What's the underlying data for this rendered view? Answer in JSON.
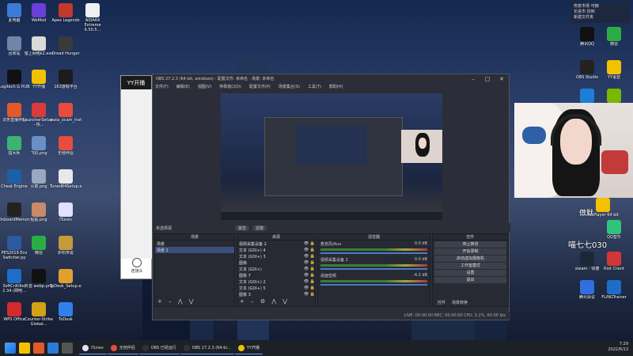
{
  "desktop_left_col1": [
    {
      "label": "此电脑",
      "color": "#3a7bd5"
    },
    {
      "label": "回收站",
      "color": "#6f86a8"
    },
    {
      "label": "Logitech G HUB",
      "color": "#111111"
    },
    {
      "label": "法务直播伴侣",
      "color": "#e05a2b"
    },
    {
      "label": "猎大师",
      "color": "#3cb371"
    },
    {
      "label": "Cheat Engine",
      "color": "#1d5fa8"
    },
    {
      "label": "OnboardMemoryManager",
      "color": "#222222"
    },
    {
      "label": "PES2019 Eco Switcher.py",
      "color": "#2c5aa0"
    },
    {
      "label": "SoftCnKiller 2.34 (网吧...",
      "color": "#1d6ec8"
    },
    {
      "label": "WPS Office",
      "color": "#d12b2b"
    }
  ],
  "desktop_left_col2": [
    {
      "label": "WeMod",
      "color": "#6a3fd8"
    },
    {
      "label": "猎上网络k2.exe",
      "color": "#d9d9d9"
    },
    {
      "label": "YY开播",
      "color": "#f2c200"
    },
    {
      "label": "LauncherSetup.exe - 快...",
      "color": "#d93b3b"
    },
    {
      "label": "飞机.png",
      "color": "#6a8fc7"
    },
    {
      "label": "火箭.png",
      "color": "#9aa8c2"
    },
    {
      "label": "贴贴.png",
      "color": "#c78a6a"
    },
    {
      "label": "微信",
      "color": "#2bad46"
    },
    {
      "label": "抖音.webp.png",
      "color": "#111111"
    },
    {
      "label": "Counter-Strike Global...",
      "color": "#d4a017"
    }
  ],
  "desktop_left_col3": [
    {
      "label": "Apex Legends",
      "color": "#c0392b"
    },
    {
      "label": "Dread Hunger",
      "color": "#3a3a3a"
    },
    {
      "label": "163游戏平台",
      "color": "#1c1c1c"
    },
    {
      "label": "wuta_ocam_installer_1.4...",
      "color": "#e74c3c"
    },
    {
      "label": "无他伴侣",
      "color": "#e74c3c"
    },
    {
      "label": "Tuned64Setup.exe",
      "color": "#e8e8e8"
    },
    {
      "label": "iTunes",
      "color": "#e0e0ff"
    },
    {
      "label": "炉石传说",
      "color": "#c49a3a"
    },
    {
      "label": "ToDesk_Setup.exe",
      "color": "#e0a030"
    },
    {
      "label": "ToDesk",
      "color": "#2f80ed"
    }
  ],
  "desktop_left_col4": [
    {
      "label": "AIDA64 Extreme 6.50.5...",
      "color": "#f0f0f0"
    }
  ],
  "desktop_right": [
    {
      "label": "腾讯QQ",
      "color": "#111111"
    },
    {
      "label": "微信",
      "color": "#2bad46"
    },
    {
      "label": "OBS Studio",
      "color": "#222222"
    },
    {
      "label": "YY语音",
      "color": "#f2c200"
    },
    {
      "label": "",
      "color": "#1c7ed6"
    },
    {
      "label": "",
      "color": "#76b900"
    },
    {
      "label": "PotPlayer 64 bit",
      "color": "#f2c200"
    },
    {
      "label": "QQ音乐",
      "color": "#31c27c"
    },
    {
      "label": "steam - 快捷",
      "color": "#1b2838"
    },
    {
      "label": "Riot Client",
      "color": "#d13639"
    },
    {
      "label": "腾讯会议",
      "color": "#2f6fe0"
    },
    {
      "label": "FLiNGTrainer",
      "color": "#1d6ec8"
    }
  ],
  "notification": {
    "line1": "恢复市场 可拥",
    "line2": "长进市 找到",
    "line3": "新建文件夹"
  },
  "overlay": {
    "name1": "傲默",
    "name2": "喵七七030"
  },
  "yy": {
    "title": "YY开播",
    "button": "连接头"
  },
  "obs": {
    "title": "OBS 27.2.3 (64-bit, windows) - 配置文件: 未命名 - 场景: 未命名",
    "menu": [
      "文件(F)",
      "编辑(E)",
      "视图(V)",
      "停靠窗口(D)",
      "配置文件(P)",
      "场景集合(S)",
      "工具(T)",
      "帮助(H)"
    ],
    "midbar_label": "未选择源",
    "midbar_props": "属性",
    "midbar_filters": "滤镜",
    "docks": {
      "scenes": {
        "title": "场景",
        "items": [
          "场景",
          "场景 2"
        ]
      },
      "sources": {
        "title": "来源",
        "items": [
          "视频采集设备 2",
          "文本 (GDI+) 4",
          "文本 (GDI+) 3",
          "图像",
          "文本 (GDI+)",
          "图像 7",
          "文本 (GDI+) 2",
          "文本 (GDI+) 5",
          "图像 3"
        ]
      },
      "mixer": {
        "title": "混音器",
        "tracks": [
          {
            "name": "麦克风/Aux",
            "db": "0.0 dB"
          },
          {
            "name": "视频采集设备 2",
            "db": "0.0 dB"
          },
          {
            "name": "桌面音频",
            "db": "-4.2 dB"
          }
        ]
      },
      "controls": {
        "title": "控件",
        "buttons": [
          "停止推流",
          "开始录制",
          "启动虚拟摄像机",
          "工作室模式",
          "设置",
          "退出"
        ]
      }
    },
    "dock_tabs": [
      "控件",
      "场景转换"
    ],
    "status": "LIVE: 00:00:00   REC: 00:00:00   CPU: 3.1%, 60.00 fps"
  },
  "taskbar": {
    "apps": [
      {
        "label": "iTunes",
        "color": "#e0e0ff"
      },
      {
        "label": "无他伴侣",
        "color": "#e74c3c"
      },
      {
        "label": "OBS 已经运行",
        "color": "#333333"
      },
      {
        "label": "OBS 27.2.3 (64-bi...",
        "color": "#333333"
      },
      {
        "label": "YY开播",
        "color": "#f2c200"
      }
    ],
    "time": "7:29",
    "date": "2022/6/13"
  }
}
